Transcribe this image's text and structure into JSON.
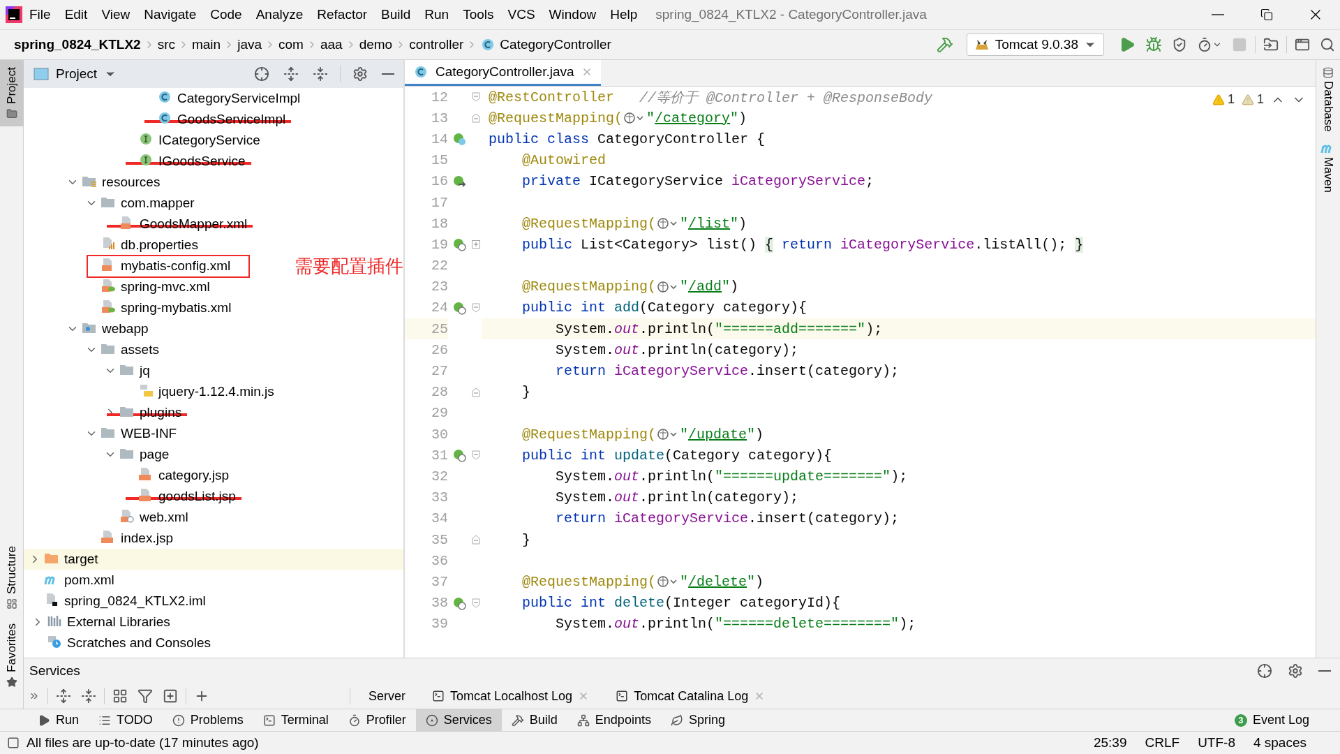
{
  "window": {
    "title": "spring_0824_KTLX2 - CategoryController.java"
  },
  "menu": [
    "File",
    "Edit",
    "View",
    "Navigate",
    "Code",
    "Analyze",
    "Refactor",
    "Build",
    "Run",
    "Tools",
    "VCS",
    "Window",
    "Help"
  ],
  "breadcrumbs": [
    {
      "label": "spring_0824_KTLX2",
      "kind": "project"
    },
    {
      "label": "src",
      "kind": "dir"
    },
    {
      "label": "main",
      "kind": "dir"
    },
    {
      "label": "java",
      "kind": "dir"
    },
    {
      "label": "com",
      "kind": "dir"
    },
    {
      "label": "aaa",
      "kind": "dir"
    },
    {
      "label": "demo",
      "kind": "dir"
    },
    {
      "label": "controller",
      "kind": "dir"
    },
    {
      "label": "CategoryController",
      "kind": "class"
    }
  ],
  "run_config": {
    "label": "Tomcat 9.0.38"
  },
  "side_left_top": [
    {
      "label": "Project",
      "selected": true
    }
  ],
  "side_left_bottom": [
    {
      "label": "Structure",
      "selected": false
    },
    {
      "label": "Favorites",
      "selected": false
    }
  ],
  "side_right": [
    {
      "label": "Database",
      "kind": "database"
    },
    {
      "label": "Maven",
      "kind": "maven"
    }
  ],
  "project": {
    "title": "Project",
    "tree": [
      {
        "children": [
          {
            "children": [
              {
                "children": [
                  {
                    "children": [
                      {
                        "children": [
                          {
                            "children": [
                              {
                                "children": [
                                  {
                                    "label": "CategoryServiceImpl",
                                    "kind": "class",
                                    "struck": false,
                                    "boxed": false,
                                    "highlighted": false
                                  },
                                  {
                                    "label": "GoodsServiceImpl",
                                    "kind": "class",
                                    "struck": true,
                                    "boxed": false,
                                    "highlighted": false
                                  }
                                ]
                              },
                              {
                                "label": "ICategoryService",
                                "kind": "interface",
                                "struck": false,
                                "boxed": false,
                                "highlighted": false
                              },
                              {
                                "label": "IGoodsService",
                                "kind": "interface",
                                "struck": true,
                                "boxed": false,
                                "highlighted": false
                              }
                            ]
                          }
                        ]
                      }
                    ]
                  },
                  {
                    "label": "resources",
                    "kind": "resources-folder",
                    "expanded": true,
                    "struck": false,
                    "boxed": false,
                    "highlighted": false,
                    "children": [
                      {
                        "label": "com.mapper",
                        "kind": "folder",
                        "expanded": true,
                        "struck": false,
                        "boxed": false,
                        "highlighted": false,
                        "children": [
                          {
                            "label": "GoodsMapper.xml",
                            "kind": "xml",
                            "struck": true,
                            "boxed": false,
                            "highlighted": false
                          }
                        ]
                      },
                      {
                        "label": "db.properties",
                        "kind": "properties",
                        "struck": false,
                        "boxed": false,
                        "highlighted": false
                      },
                      {
                        "label": "mybatis-config.xml",
                        "kind": "xml",
                        "struck": false,
                        "boxed": true,
                        "highlighted": false,
                        "note": "需要配置插件"
                      },
                      {
                        "label": "spring-mvc.xml",
                        "kind": "spring-xml",
                        "struck": false,
                        "boxed": false,
                        "highlighted": false
                      },
                      {
                        "label": "spring-mybatis.xml",
                        "kind": "spring-xml",
                        "struck": false,
                        "boxed": false,
                        "highlighted": false
                      }
                    ]
                  },
                  {
                    "label": "webapp",
                    "kind": "web-folder",
                    "expanded": true,
                    "struck": false,
                    "boxed": false,
                    "highlighted": false,
                    "children": [
                      {
                        "label": "assets",
                        "kind": "folder",
                        "expanded": true,
                        "struck": false,
                        "boxed": false,
                        "highlighted": false,
                        "children": [
                          {
                            "label": "jq",
                            "kind": "folder",
                            "expanded": true,
                            "struck": false,
                            "boxed": false,
                            "highlighted": false,
                            "children": [
                              {
                                "label": "jquery-1.12.4.min.js",
                                "kind": "js",
                                "struck": false,
                                "boxed": false,
                                "highlighted": false
                              }
                            ]
                          },
                          {
                            "label": "plugins",
                            "kind": "folder",
                            "expanded": false,
                            "struck": true,
                            "boxed": false,
                            "highlighted": false
                          }
                        ]
                      },
                      {
                        "label": "WEB-INF",
                        "kind": "folder",
                        "expanded": true,
                        "struck": false,
                        "boxed": false,
                        "highlighted": false,
                        "children": [
                          {
                            "label": "page",
                            "kind": "folder",
                            "expanded": true,
                            "struck": false,
                            "boxed": false,
                            "highlighted": false,
                            "children": [
                              {
                                "label": "category.jsp",
                                "kind": "jsp",
                                "struck": false,
                                "boxed": false,
                                "highlighted": false
                              },
                              {
                                "label": "goodsList.jsp",
                                "kind": "jsp",
                                "struck": true,
                                "boxed": false,
                                "highlighted": false
                              }
                            ]
                          },
                          {
                            "label": "web.xml",
                            "kind": "web-xml",
                            "struck": false,
                            "boxed": false,
                            "highlighted": false
                          }
                        ]
                      },
                      {
                        "label": "index.jsp",
                        "kind": "jsp",
                        "struck": false,
                        "boxed": false,
                        "highlighted": false
                      }
                    ]
                  }
                ]
              }
            ]
          },
          {
            "label": "target",
            "kind": "target-folder",
            "expanded": false,
            "struck": false,
            "boxed": false,
            "highlighted": true
          },
          {
            "label": "pom.xml",
            "kind": "maven",
            "struck": false,
            "boxed": false,
            "highlighted": false
          },
          {
            "label": "spring_0824_KTLX2.iml",
            "kind": "iml",
            "struck": false,
            "boxed": false,
            "highlighted": false
          }
        ]
      },
      {
        "label": "External Libraries",
        "kind": "libraries",
        "expanded": false,
        "struck": false,
        "boxed": false,
        "highlighted": false
      },
      {
        "label": "Scratches and Consoles",
        "kind": "scratch",
        "struck": false,
        "boxed": false,
        "highlighted": false
      }
    ]
  },
  "editor": {
    "tabs": [
      {
        "label": "CategoryController.java",
        "selected": true
      }
    ],
    "inspections": [
      {
        "count": "1",
        "kind": "warning"
      },
      {
        "count": "1",
        "kind": "weak"
      }
    ],
    "lines": [
      {
        "number": "12",
        "kind": "plain",
        "fold_start": true,
        "fold_end": false,
        "collapsed": false,
        "selected": false,
        "tokens": [
          {
            "kind": "ann",
            "t": "@RestController"
          },
          {
            "kind": "comment",
            "t": "   //等价于 @Controller + @ResponseBody"
          }
        ]
      },
      {
        "number": "13",
        "kind": "plain",
        "fold_start": false,
        "fold_end": true,
        "collapsed": false,
        "selected": false,
        "tokens": [
          {
            "kind": "ann",
            "t": "@RequestMapping("
          },
          {
            "kind": "globe"
          },
          {
            "kind": "str",
            "t": "\""
          },
          {
            "kind": "link",
            "t": "/category"
          },
          {
            "kind": "str",
            "t": "\""
          },
          {
            "kind": "txt",
            "t": ")"
          }
        ]
      },
      {
        "number": "14",
        "kind": "class",
        "fold_start": false,
        "fold_end": false,
        "collapsed": false,
        "selected": false,
        "tokens": [
          {
            "kind": "kw",
            "t": "public class"
          },
          {
            "kind": "txt",
            "t": " CategoryController {"
          }
        ]
      },
      {
        "number": "15",
        "kind": "plain",
        "fold_start": false,
        "fold_end": false,
        "collapsed": false,
        "selected": false,
        "tokens": [
          {
            "kind": "ann",
            "t": "    @Autowired"
          }
        ]
      },
      {
        "number": "16",
        "kind": "inject",
        "fold_start": false,
        "fold_end": false,
        "collapsed": false,
        "selected": false,
        "tokens": [
          {
            "kind": "kw",
            "t": "    private"
          },
          {
            "kind": "txt",
            "t": " ICategoryService "
          },
          {
            "kind": "field",
            "t": "iCategoryService"
          },
          {
            "kind": "txt",
            "t": ";"
          }
        ]
      },
      {
        "number": "17",
        "kind": "plain",
        "fold_start": false,
        "fold_end": false,
        "collapsed": false,
        "selected": false
      },
      {
        "number": "18",
        "kind": "plain",
        "fold_start": false,
        "fold_end": false,
        "collapsed": false,
        "selected": false,
        "tokens": [
          {
            "kind": "ann",
            "t": "    @RequestMapping("
          },
          {
            "kind": "globe"
          },
          {
            "kind": "str",
            "t": "\""
          },
          {
            "kind": "link",
            "t": "/list"
          },
          {
            "kind": "str",
            "t": "\""
          },
          {
            "kind": "txt",
            "t": ")"
          }
        ]
      },
      {
        "number": "19",
        "kind": "web",
        "fold_start": false,
        "fold_end": false,
        "collapsed": true,
        "selected": false,
        "tokens": [
          {
            "kind": "kw",
            "t": "    public"
          },
          {
            "kind": "txt",
            "t": " List<Category> list() "
          },
          {
            "kind": "brace",
            "t": "{"
          },
          {
            "kind": "kw",
            "t": " return"
          },
          {
            "kind": "field",
            "t": " iCategoryService"
          },
          {
            "kind": "txt",
            "t": ".listAll(); "
          },
          {
            "kind": "brace",
            "t": "}"
          }
        ]
      },
      {
        "number": "22",
        "kind": "plain",
        "fold_start": false,
        "fold_end": false,
        "collapsed": false,
        "selected": false
      },
      {
        "number": "23",
        "kind": "plain",
        "fold_start": false,
        "fold_end": false,
        "collapsed": false,
        "selected": false,
        "tokens": [
          {
            "kind": "ann",
            "t": "    @RequestMapping("
          },
          {
            "kind": "globe"
          },
          {
            "kind": "str",
            "t": "\""
          },
          {
            "kind": "link",
            "t": "/add"
          },
          {
            "kind": "str",
            "t": "\""
          },
          {
            "kind": "txt",
            "t": ")"
          }
        ]
      },
      {
        "number": "24",
        "kind": "web",
        "fold_start": true,
        "fold_end": false,
        "collapsed": false,
        "selected": false,
        "tokens": [
          {
            "kind": "kw",
            "t": "    public int"
          },
          {
            "kind": "fn",
            "t": " add"
          },
          {
            "kind": "txt",
            "t": "(Category category){"
          }
        ]
      },
      {
        "number": "25",
        "kind": "plain",
        "fold_start": false,
        "fold_end": false,
        "collapsed": false,
        "selected": true,
        "tokens": [
          {
            "kind": "txt",
            "t": "        System."
          },
          {
            "kind": "static",
            "t": "out"
          },
          {
            "kind": "txt",
            "t": ".println("
          },
          {
            "kind": "str",
            "t": "\"======add=======\""
          },
          {
            "kind": "txt",
            "t": ");"
          }
        ]
      },
      {
        "number": "26",
        "kind": "plain",
        "fold_start": false,
        "fold_end": false,
        "collapsed": false,
        "selected": false,
        "tokens": [
          {
            "kind": "txt",
            "t": "        System."
          },
          {
            "kind": "static",
            "t": "out"
          },
          {
            "kind": "txt",
            "t": ".println(category);"
          }
        ]
      },
      {
        "number": "27",
        "kind": "plain",
        "fold_start": false,
        "fold_end": false,
        "collapsed": false,
        "selected": false,
        "tokens": [
          {
            "kind": "kw",
            "t": "        return"
          },
          {
            "kind": "field",
            "t": " iCategoryService"
          },
          {
            "kind": "txt",
            "t": ".insert(category);"
          }
        ]
      },
      {
        "number": "28",
        "kind": "plain",
        "fold_start": false,
        "fold_end": true,
        "collapsed": false,
        "selected": false,
        "tokens": [
          {
            "kind": "txt",
            "t": "    }"
          }
        ]
      },
      {
        "number": "29",
        "kind": "plain",
        "fold_start": false,
        "fold_end": false,
        "collapsed": false,
        "selected": false
      },
      {
        "number": "30",
        "kind": "plain",
        "fold_start": false,
        "fold_end": false,
        "collapsed": false,
        "selected": false,
        "tokens": [
          {
            "kind": "ann",
            "t": "    @RequestMapping("
          },
          {
            "kind": "globe"
          },
          {
            "kind": "str",
            "t": "\""
          },
          {
            "kind": "link",
            "t": "/update"
          },
          {
            "kind": "str",
            "t": "\""
          },
          {
            "kind": "txt",
            "t": ")"
          }
        ]
      },
      {
        "number": "31",
        "kind": "web",
        "fold_start": true,
        "fold_end": false,
        "collapsed": false,
        "selected": false,
        "tokens": [
          {
            "kind": "kw",
            "t": "    public int"
          },
          {
            "kind": "fn",
            "t": " update"
          },
          {
            "kind": "txt",
            "t": "(Category category){"
          }
        ]
      },
      {
        "number": "32",
        "kind": "plain",
        "fold_start": false,
        "fold_end": false,
        "collapsed": false,
        "selected": false,
        "tokens": [
          {
            "kind": "txt",
            "t": "        System."
          },
          {
            "kind": "static",
            "t": "out"
          },
          {
            "kind": "txt",
            "t": ".println("
          },
          {
            "kind": "str",
            "t": "\"======update=======\""
          },
          {
            "kind": "txt",
            "t": ");"
          }
        ]
      },
      {
        "number": "33",
        "kind": "plain",
        "fold_start": false,
        "fold_end": false,
        "collapsed": false,
        "selected": false,
        "tokens": [
          {
            "kind": "txt",
            "t": "        System."
          },
          {
            "kind": "static",
            "t": "out"
          },
          {
            "kind": "txt",
            "t": ".println(category);"
          }
        ]
      },
      {
        "number": "34",
        "kind": "plain",
        "fold_start": false,
        "fold_end": false,
        "collapsed": false,
        "selected": false,
        "tokens": [
          {
            "kind": "kw",
            "t": "        return"
          },
          {
            "kind": "field",
            "t": " iCategoryService"
          },
          {
            "kind": "txt",
            "t": ".insert(category);"
          }
        ]
      },
      {
        "number": "35",
        "kind": "plain",
        "fold_start": false,
        "fold_end": true,
        "collapsed": false,
        "selected": false,
        "tokens": [
          {
            "kind": "txt",
            "t": "    }"
          }
        ]
      },
      {
        "number": "36",
        "kind": "plain",
        "fold_start": false,
        "fold_end": false,
        "collapsed": false,
        "selected": false
      },
      {
        "number": "37",
        "kind": "plain",
        "fold_start": false,
        "fold_end": false,
        "collapsed": false,
        "selected": false,
        "tokens": [
          {
            "kind": "ann",
            "t": "    @RequestMapping("
          },
          {
            "kind": "globe"
          },
          {
            "kind": "str",
            "t": "\""
          },
          {
            "kind": "link",
            "t": "/delete"
          },
          {
            "kind": "str",
            "t": "\""
          },
          {
            "kind": "txt",
            "t": ")"
          }
        ]
      },
      {
        "number": "38",
        "kind": "web",
        "fold_start": true,
        "fold_end": false,
        "collapsed": false,
        "selected": false,
        "tokens": [
          {
            "kind": "kw",
            "t": "    public int"
          },
          {
            "kind": "fn",
            "t": " delete"
          },
          {
            "kind": "txt",
            "t": "(Integer categoryId){"
          }
        ]
      },
      {
        "number": "39",
        "kind": "plain",
        "fold_start": false,
        "fold_end": false,
        "collapsed": false,
        "selected": false,
        "tokens": [
          {
            "kind": "txt",
            "t": "        System."
          },
          {
            "kind": "static",
            "t": "out"
          },
          {
            "kind": "txt",
            "t": ".println("
          },
          {
            "kind": "str",
            "t": "\"======delete========\""
          },
          {
            "kind": "txt",
            "t": ");"
          }
        ]
      }
    ]
  },
  "services": {
    "title": "Services",
    "tabs": [
      {
        "label": "Server",
        "closable": false,
        "selected": false
      },
      {
        "label": "Tomcat Localhost Log",
        "closable": true,
        "selected": false
      },
      {
        "label": "Tomcat Catalina Log",
        "closable": true,
        "selected": false
      }
    ]
  },
  "tool_strip": [
    {
      "label": "Run",
      "kind": "run",
      "selected": false
    },
    {
      "label": "TODO",
      "kind": "todo",
      "selected": false
    },
    {
      "label": "Problems",
      "kind": "problems",
      "selected": false
    },
    {
      "label": "Terminal",
      "kind": "terminal",
      "selected": false
    },
    {
      "label": "Profiler",
      "kind": "profiler",
      "selected": false
    },
    {
      "label": "Services",
      "kind": "services",
      "selected": true
    },
    {
      "label": "Build",
      "kind": "build",
      "selected": false
    },
    {
      "label": "Endpoints",
      "kind": "endpoints",
      "selected": false
    },
    {
      "label": "Spring",
      "kind": "spring",
      "selected": false
    }
  ],
  "event_log": {
    "label": "Event Log",
    "badge": "3"
  },
  "status_bar": {
    "message": "All files are up-to-date (17 minutes ago)",
    "items": [
      "25:39",
      "CRLF",
      "UTF-8",
      "4 spaces"
    ]
  }
}
